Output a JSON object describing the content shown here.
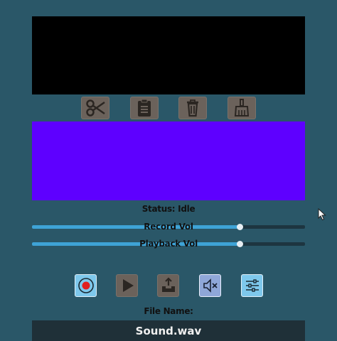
{
  "status": {
    "label": "Status: Idle"
  },
  "sliders": {
    "record": {
      "label": "Record Vol",
      "value": 0.76
    },
    "playback": {
      "label": "Playback Vol",
      "value": 0.76
    }
  },
  "edit_toolbar": {
    "icons": [
      "scissors-icon",
      "clipboard-icon",
      "trash-icon",
      "broom-icon"
    ]
  },
  "controls": {
    "icons": [
      "record-icon",
      "play-icon",
      "save-icon",
      "mute-icon",
      "settings-icon"
    ]
  },
  "file": {
    "label": "File Name:",
    "value": "Sound.wav"
  },
  "colors": {
    "background": "#2a5768",
    "waveform": "#000000",
    "visualizer": "#5e00ff",
    "slider_fill": "#3ea3d6",
    "record_dot": "#e02020"
  }
}
